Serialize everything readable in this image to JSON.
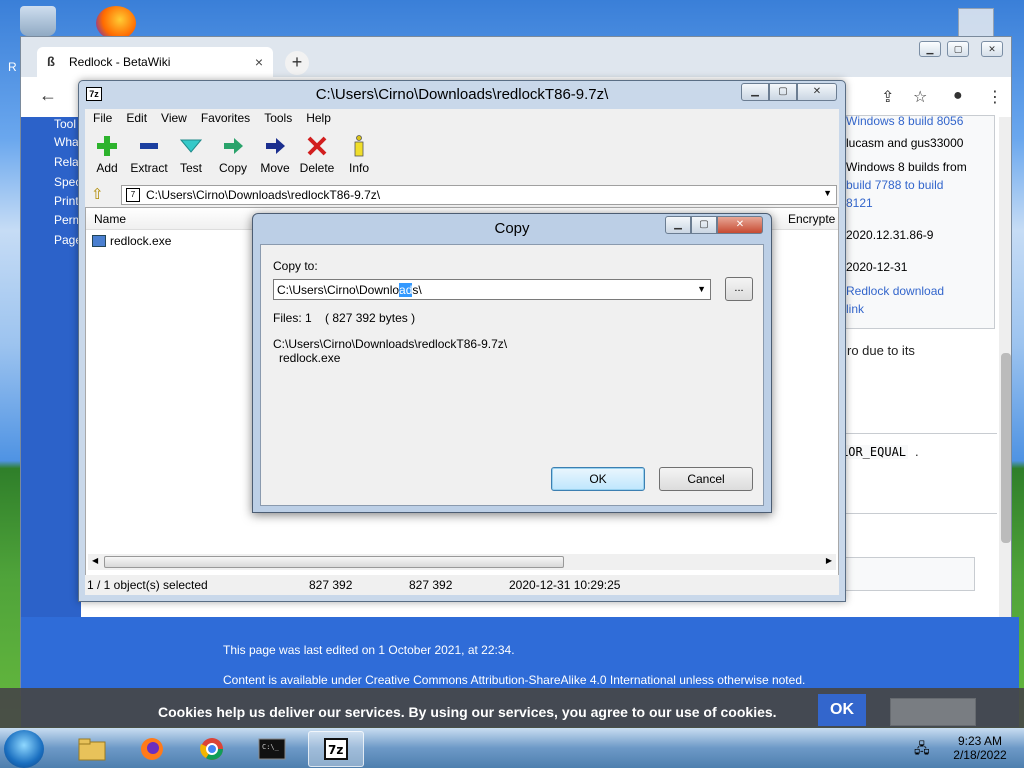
{
  "desktop": {
    "partial_label": "R"
  },
  "browser": {
    "tab_title": "Redlock - BetaWiki",
    "tab_close": "×",
    "new_tab": "+",
    "sidebar_links": [
      "Tool",
      "Wha",
      "Rela",
      "Spec",
      "Print",
      "Perm",
      "Page"
    ],
    "infobox": {
      "lines": [
        "Windows 8 build 8056",
        "lucasm and gus33000",
        "Windows 8 builds from",
        "build 7788 to build",
        "8121",
        "2020.12.31.86-9",
        "2020-12-31",
        "Redlock download",
        "link"
      ]
    },
    "body_fragment_1": "ro due to its",
    "body_fragment_2": "LOR_EQUAL",
    "body_fragment_2_tail": ".",
    "footer_edited": "This page was last edited on 1 October 2021, at 22:34.",
    "footer_license": "Content is available under Creative Commons Attribution-ShareAlike 4.0 International unless otherwise noted."
  },
  "cookie": {
    "text": "Cookies help us deliver our services. By using our services, you agree to our use of cookies.",
    "ok": "OK"
  },
  "sevenzip": {
    "title": "C:\\Users\\Cirno\\Downloads\\redlockT86-9.7z\\",
    "app_icon": "7z",
    "menu": [
      "File",
      "Edit",
      "View",
      "Favorites",
      "Tools",
      "Help"
    ],
    "toolbar": [
      {
        "label": "Add",
        "icon": "add-icon"
      },
      {
        "label": "Extract",
        "icon": "extract-icon"
      },
      {
        "label": "Test",
        "icon": "test-icon"
      },
      {
        "label": "Copy",
        "icon": "copy-icon"
      },
      {
        "label": "Move",
        "icon": "move-icon"
      },
      {
        "label": "Delete",
        "icon": "delete-icon"
      },
      {
        "label": "Info",
        "icon": "info-icon"
      }
    ],
    "address": "C:\\Users\\Cirno\\Downloads\\redlockT86-9.7z\\",
    "columns": {
      "name": "Name",
      "encrypted": "Encrypte"
    },
    "files": [
      {
        "name": "redlock.exe"
      }
    ],
    "status": {
      "selected": "1 / 1 object(s) selected",
      "size": "827 392",
      "packed": "827 392",
      "modified": "2020-12-31 10:29:25"
    }
  },
  "copy_dialog": {
    "title": "Copy",
    "copy_to_label": "Copy to:",
    "path_before": "C:\\Users\\Cirno\\Downlo",
    "path_selected": "ad",
    "path_after": "s\\",
    "browse": "...",
    "files_info": "Files: 1    ( 827 392 bytes )",
    "source_path": "C:\\Users\\Cirno\\Downloads\\redlockT86-9.7z\\",
    "source_file": "redlock.exe",
    "ok": "OK",
    "cancel": "Cancel"
  },
  "taskbar": {
    "time": "9:23 AM",
    "date": "2/18/2022",
    "active_app": "7z"
  }
}
